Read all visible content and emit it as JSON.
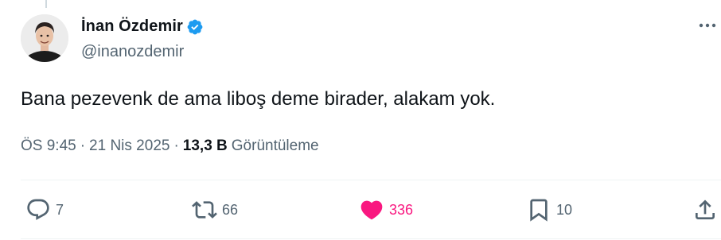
{
  "author": {
    "display_name": "İnan Özdemir",
    "handle": "@inanozdemir",
    "verified": true,
    "verified_color": "#1d9bf0"
  },
  "tweet": {
    "text": "Bana pezevenk de ama liboş deme birader, alakam yok."
  },
  "meta": {
    "time": "ÖS 9:45",
    "date": "21 Nis 2025",
    "views_count": "13,3 B",
    "views_label": "Görüntüleme",
    "separator": "·"
  },
  "actions": {
    "reply_count": "7",
    "retweet_count": "66",
    "like_count": "336",
    "bookmark_count": "10",
    "like_color": "#f91880",
    "muted_color": "#536471"
  }
}
